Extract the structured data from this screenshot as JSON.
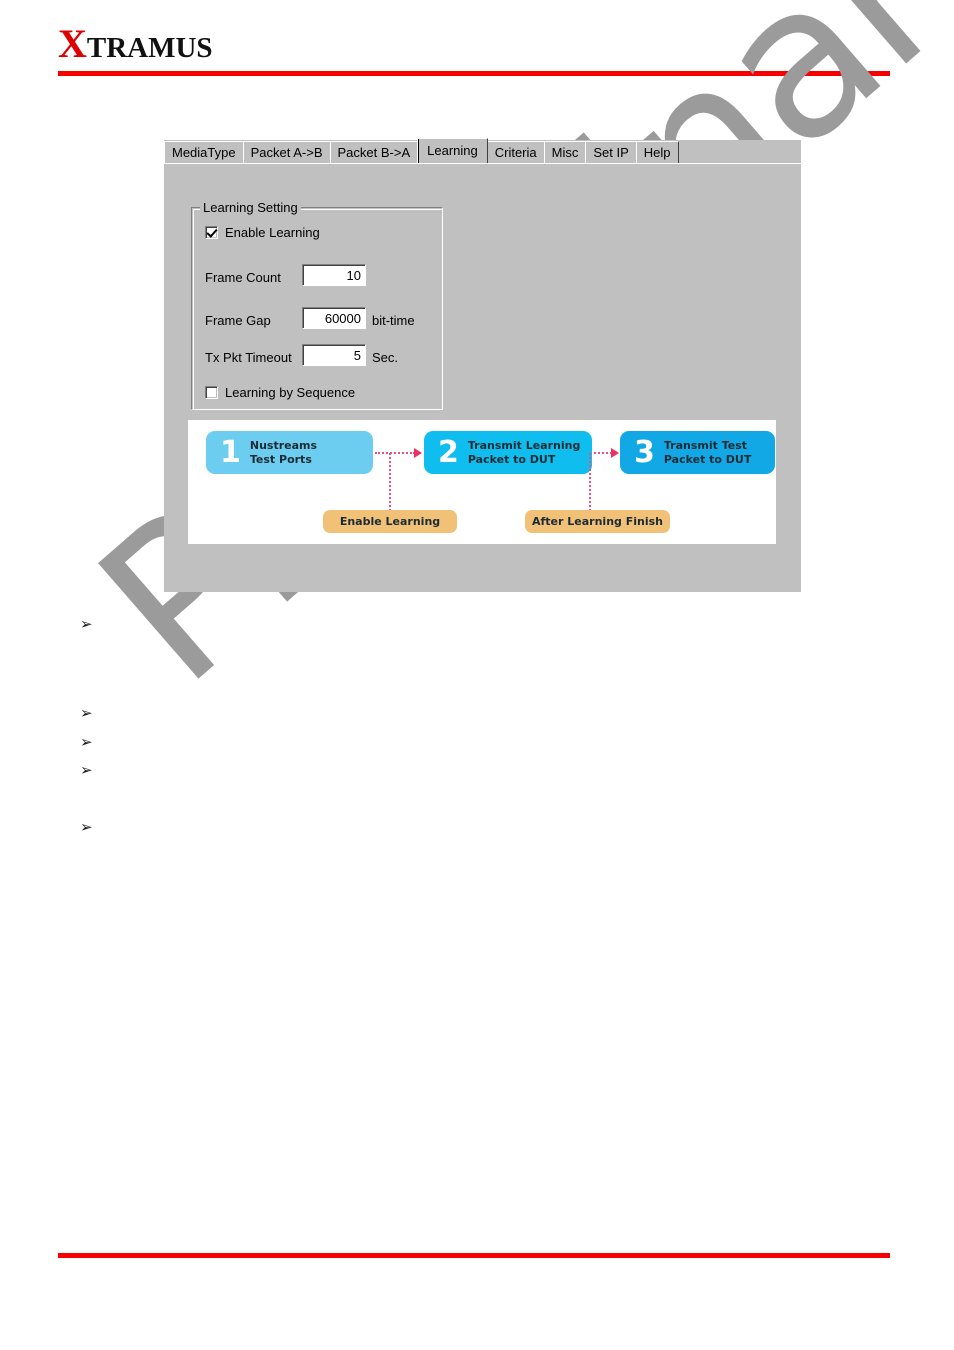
{
  "brand": {
    "initial": "X",
    "rest": "TRAMUS"
  },
  "watermark": {
    "text": "Preliminary",
    "color": "#9b9b9b"
  },
  "dialog": {
    "tabs": [
      {
        "label": "MediaType",
        "active": false
      },
      {
        "label": "Packet A->B",
        "active": false
      },
      {
        "label": "Packet B->A",
        "active": false
      },
      {
        "label": "Learning",
        "active": true
      },
      {
        "label": "Criteria",
        "active": false
      },
      {
        "label": "Misc",
        "active": false
      },
      {
        "label": "Set IP",
        "active": false
      },
      {
        "label": "Help",
        "active": false
      }
    ],
    "group": {
      "title": "Learning Setting",
      "enable_learning": {
        "label": "Enable Learning",
        "checked": true
      },
      "fields": [
        {
          "label": "Frame Count",
          "value": "10",
          "unit": ""
        },
        {
          "label": "Frame Gap",
          "value": "60000",
          "unit": "bit-time"
        },
        {
          "label": "Tx Pkt Timeout",
          "value": "5",
          "unit": "Sec."
        }
      ],
      "learning_by_sequence": {
        "label": "Learning by Sequence",
        "checked": false
      }
    },
    "diagram": {
      "steps": [
        {
          "number": "1",
          "line1": "Nustreams",
          "line2": "Test Ports",
          "color": "#6ccdf0"
        },
        {
          "number": "2",
          "line1": "Transmit Learning",
          "line2": "Packet to DUT",
          "color": "#0fbdee"
        },
        {
          "number": "3",
          "line1": "Transmit Test",
          "line2": "Packet to DUT",
          "color": "#12a8e6"
        }
      ],
      "callouts": [
        {
          "label": "Enable Learning"
        },
        {
          "label": "After Learning Finish"
        }
      ],
      "connector_color": "#ee4d7d"
    }
  },
  "bullets": [
    {
      "marker": "➢"
    },
    {
      "marker": "➢"
    },
    {
      "marker": "➢"
    },
    {
      "marker": "➢"
    },
    {
      "marker": "➢"
    }
  ]
}
